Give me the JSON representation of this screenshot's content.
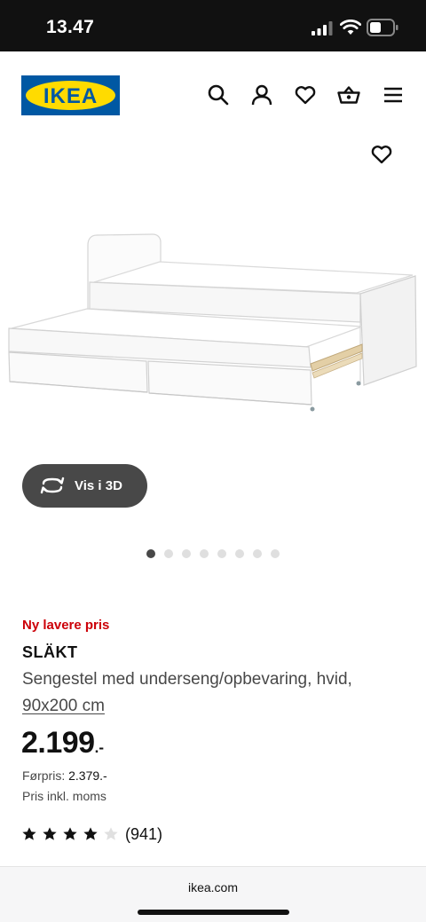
{
  "status_bar": {
    "time": "13.47",
    "icons": [
      "cellular-signal-icon",
      "wifi-icon",
      "battery-icon"
    ]
  },
  "header": {
    "logo_text": "IKEA",
    "icons": [
      "search-icon",
      "profile-icon",
      "heart-icon",
      "cart-icon",
      "menu-icon"
    ]
  },
  "product_image": {
    "alt": "SLÄKT bed frame with underbed and storage, white",
    "view_3d_label": "Vis i 3D",
    "slide_count": 8,
    "active_slide": 1
  },
  "product": {
    "badge": "Ny lavere pris",
    "name": "SLÄKT",
    "description": "Sengestel med underseng/opbevaring, hvid,",
    "size": "90x200 cm",
    "price_integer": "2.199",
    "price_decimal": ".-",
    "previous_price_label": "Førpris:",
    "previous_price": "2.379.-",
    "vat_note": "Pris inkl. moms",
    "rating": 4,
    "rating_max": 5,
    "review_count": "(941)"
  },
  "browser": {
    "url": "ikea.com"
  },
  "colors": {
    "brand_blue": "#0058a3",
    "brand_yellow": "#ffdb00",
    "sale_red": "#cc0008"
  }
}
